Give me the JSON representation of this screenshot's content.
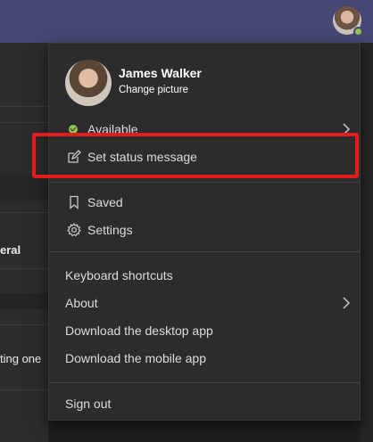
{
  "background": {
    "partial_labels": [
      "eral",
      "ting one"
    ]
  },
  "profile": {
    "name": "James Walker",
    "change_picture": "Change picture"
  },
  "menu": {
    "status": "Available",
    "set_status_message": "Set status message",
    "saved": "Saved",
    "settings": "Settings",
    "keyboard_shortcuts": "Keyboard shortcuts",
    "about": "About",
    "download_desktop": "Download the desktop app",
    "download_mobile": "Download the mobile app",
    "sign_out": "Sign out"
  },
  "colors": {
    "topbar": "#464775",
    "presence_available": "#92c353",
    "highlight_box": "#e41c1c"
  },
  "icons": [
    "pencil-square-icon",
    "bookmark-icon",
    "gear-icon",
    "chevron-right-icon"
  ]
}
